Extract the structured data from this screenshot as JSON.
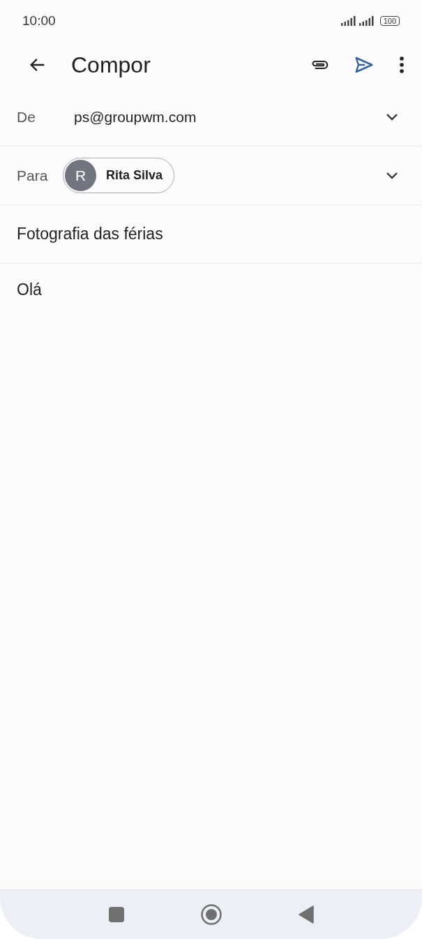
{
  "status_bar": {
    "time": "10:00",
    "battery": "100"
  },
  "app_bar": {
    "title": "Compor"
  },
  "from": {
    "label": "De",
    "value": "ps@groupwm.com"
  },
  "to": {
    "label": "Para",
    "recipients": [
      {
        "initial": "R",
        "name": "Rita Silva"
      }
    ]
  },
  "subject": {
    "value": "Fotografia das férias"
  },
  "body": {
    "value": "Olá"
  }
}
